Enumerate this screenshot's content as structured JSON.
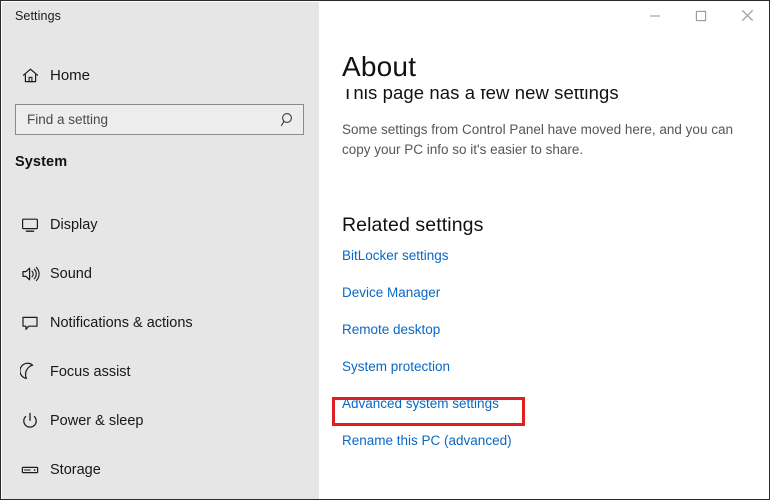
{
  "window": {
    "title": "Settings",
    "controls": [
      {
        "name": "minimize",
        "glyph": "minimize-icon"
      },
      {
        "name": "maximize",
        "glyph": "maximize-icon"
      },
      {
        "name": "close",
        "glyph": "close-icon"
      }
    ]
  },
  "sidebar": {
    "home": {
      "label": "Home",
      "icon": "home-icon"
    },
    "search": {
      "value": "",
      "placeholder": "Find a setting",
      "icon": "search-icon"
    },
    "group_title": "System",
    "items": [
      {
        "label": "Display",
        "icon": "monitor-icon"
      },
      {
        "label": "Sound",
        "icon": "speaker-icon"
      },
      {
        "label": "Notifications & actions",
        "icon": "speech-bubble-icon"
      },
      {
        "label": "Focus assist",
        "icon": "moon-icon"
      },
      {
        "label": "Power & sleep",
        "icon": "power-icon"
      },
      {
        "label": "Storage",
        "icon": "drive-icon"
      }
    ]
  },
  "main": {
    "page_title": "About",
    "subtitle": "This page has a few new settings",
    "description": "Some settings from Control Panel have moved here, and you can copy your PC info so it's easier to share.",
    "related_title": "Related settings",
    "links": [
      "BitLocker settings",
      "Device Manager",
      "Remote desktop",
      "System protection",
      "Advanced system settings",
      "Rename this PC (advanced)"
    ],
    "highlighted_link": "Advanced system settings"
  },
  "colors": {
    "link": "#0a68c4",
    "highlight": "#e02020",
    "sidebar_bg": "#e6e6e6",
    "main_bg": "#ffffff"
  }
}
